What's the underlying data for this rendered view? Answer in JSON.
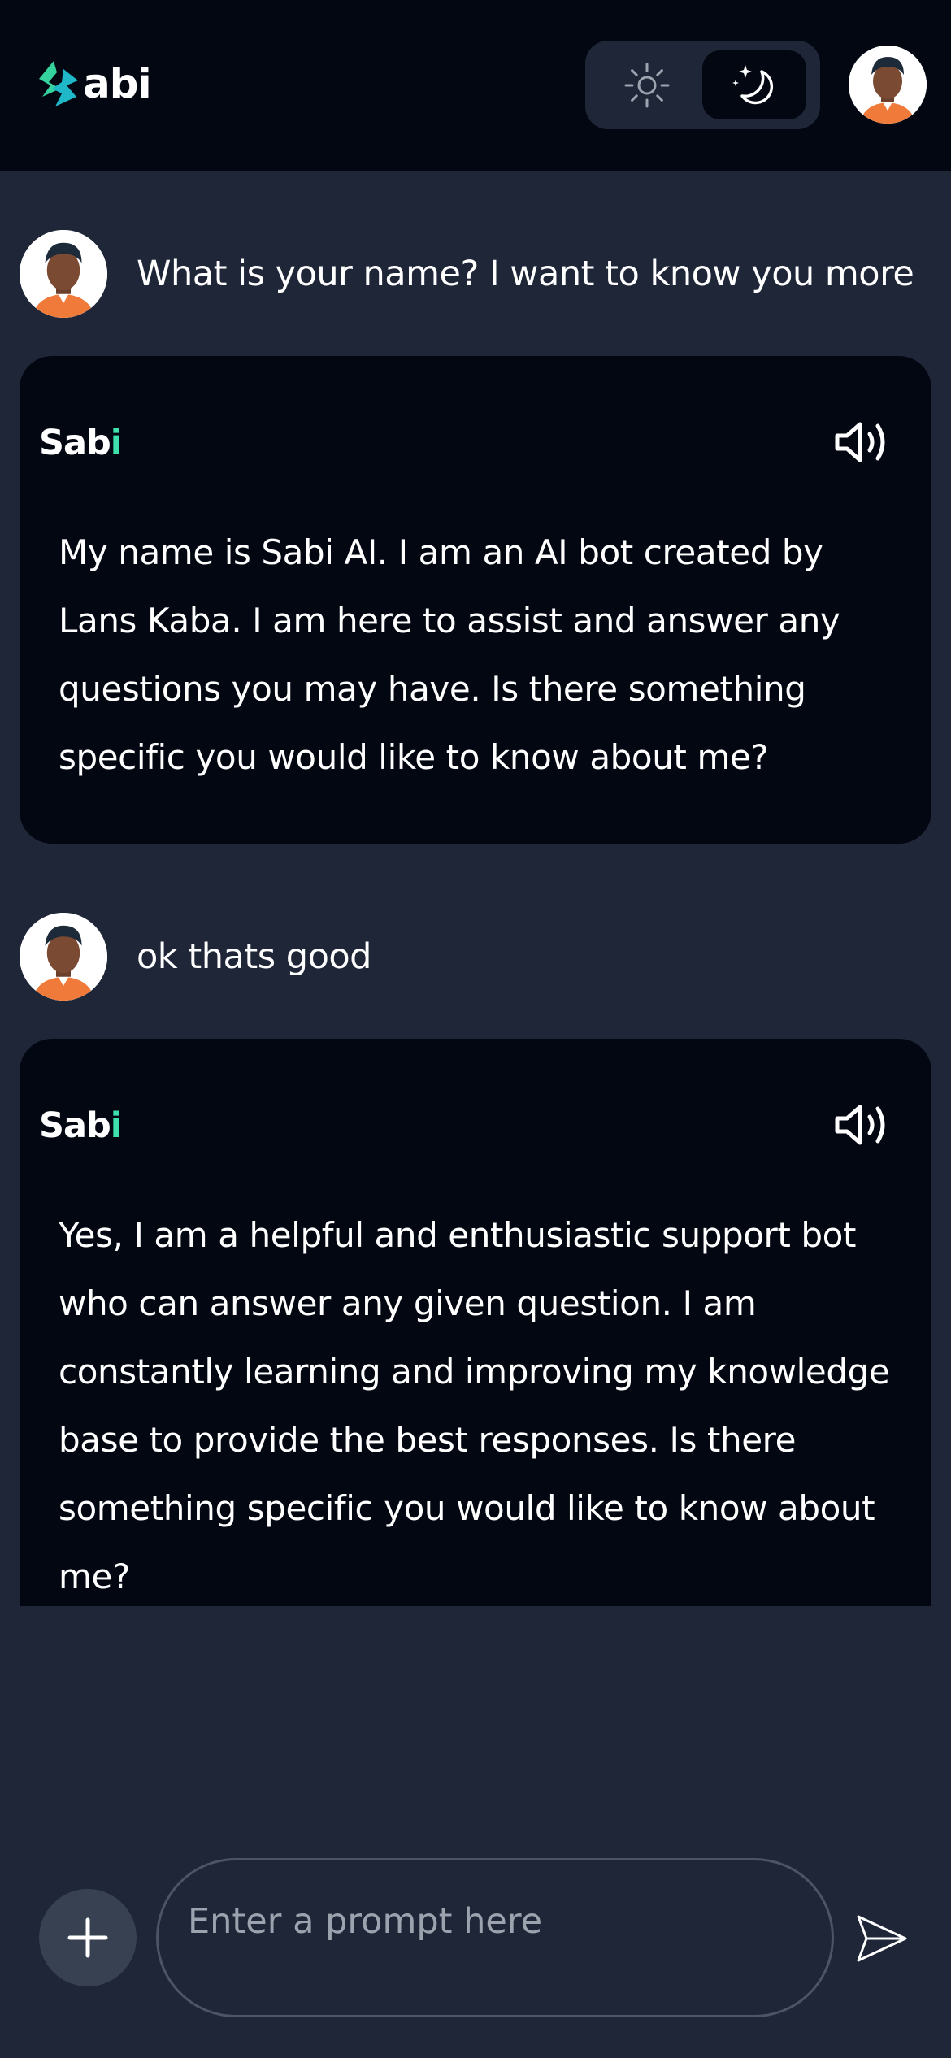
{
  "header": {
    "logo_text": "abi",
    "logo_mark_letter": "S",
    "theme_toggle": {
      "light_icon": "sun-icon",
      "dark_icon": "moon-stars-icon",
      "active": "dark"
    }
  },
  "conversation": [
    {
      "user": {
        "text": "What is your name? I want to know you more"
      },
      "bot": {
        "name_prefix": "Sab",
        "name_accent": "i",
        "text": "My name is Sabi AI. I am an AI bot created by Lans Kaba. I am here to assist and answer any questions you may have. Is there something specific you would like to know about me?"
      }
    },
    {
      "user": {
        "text": "ok thats good"
      },
      "bot": {
        "name_prefix": "Sab",
        "name_accent": "i",
        "text": "Yes, I am a helpful and enthusiastic support bot who can answer any given question. I am constantly learning and improving my knowledge base to provide the best responses. Is there something specific you would like to know about me?"
      }
    }
  ],
  "composer": {
    "placeholder": "Enter a prompt here",
    "value": ""
  },
  "colors": {
    "background": "#1e2638",
    "header_bg": "#030712",
    "card_bg": "#030712",
    "accent": "#3ee0ac",
    "input_border": "#4b5563",
    "add_button_bg": "#374151"
  }
}
